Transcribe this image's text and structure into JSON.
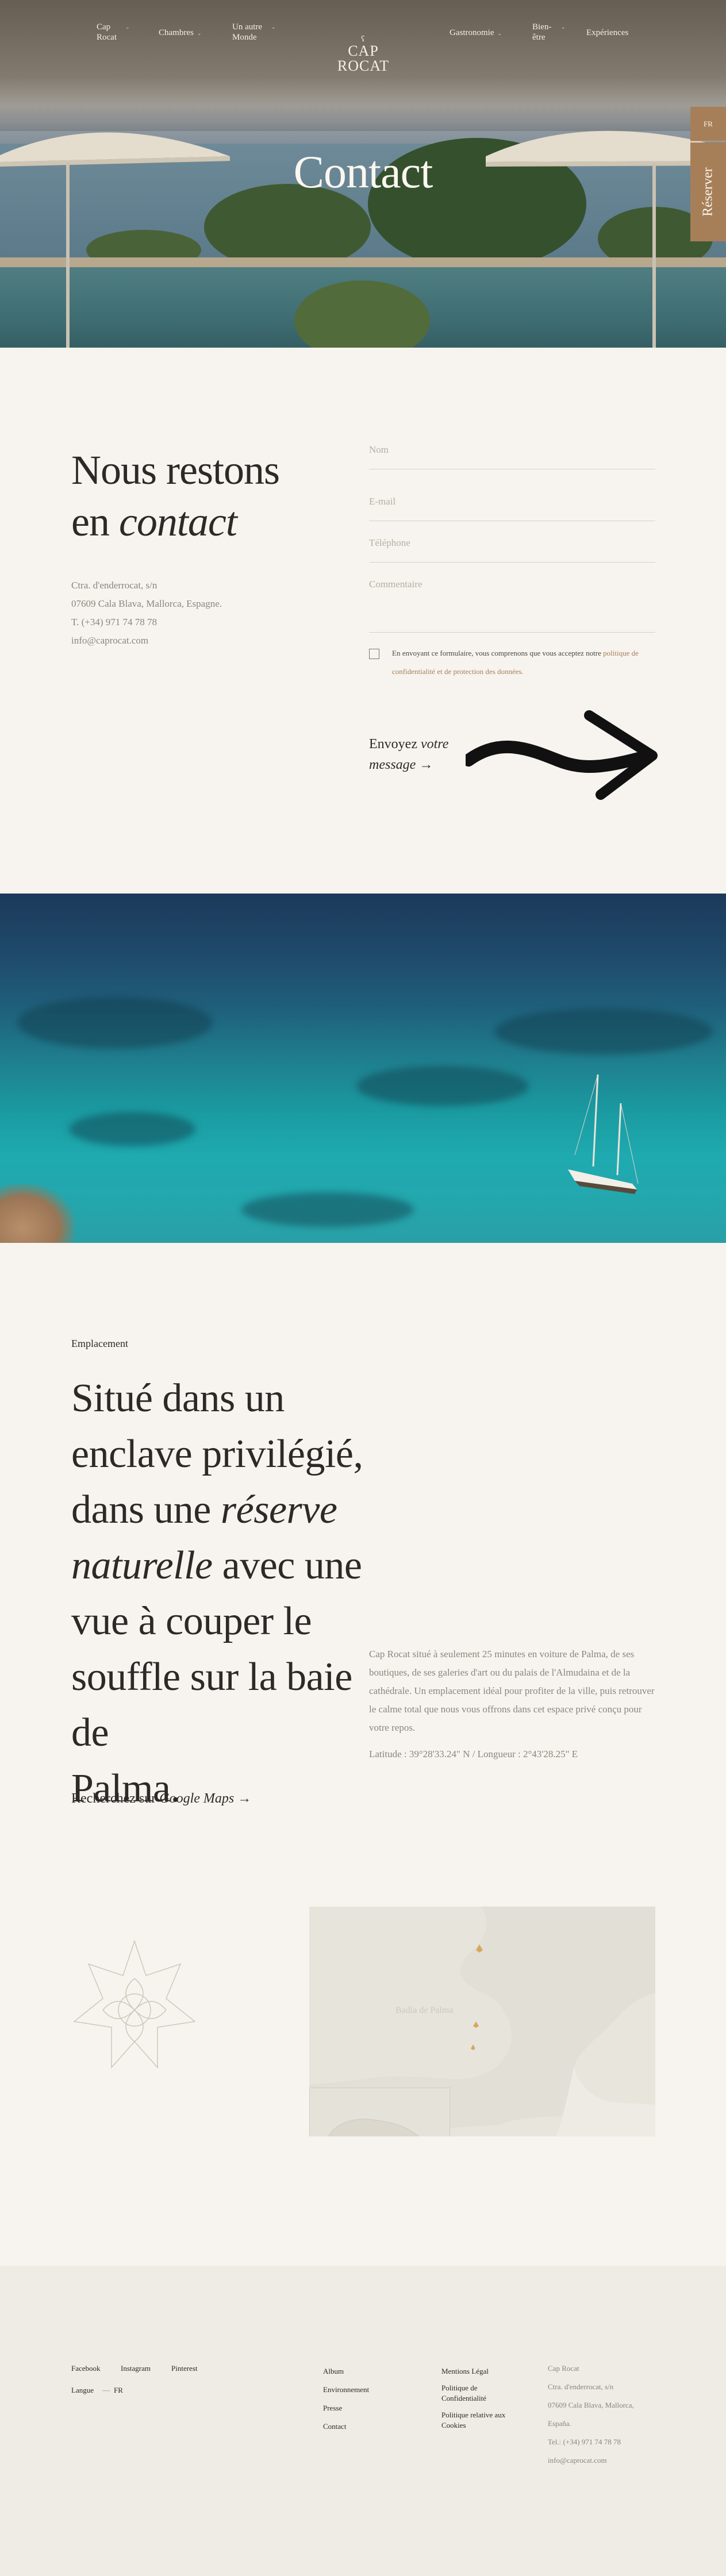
{
  "header": {
    "nav_left": [
      "Cap Rocat",
      "Chambres",
      "Un autre Monde"
    ],
    "nav_right": [
      "Gastronomie",
      "Bien-être",
      "Expériences"
    ],
    "logo_line1": "CAP",
    "logo_line2": "ROCAT",
    "hero_title": "Contact",
    "lang": "FR",
    "reserve": "Réserver"
  },
  "contact": {
    "title_line1": "Nous restons",
    "title_line2_prefix": "en ",
    "title_line2_em": "contact",
    "address": [
      "Ctra. d'enderrocat, s/n",
      "07609 Cala Blava, Mallorca, Espagne.",
      "T. (+34) 971 74 78 78",
      "info@caprocat.com"
    ],
    "form": {
      "name_placeholder": "Nom",
      "email_placeholder": "E-mail",
      "phone_placeholder": "Téléphone",
      "comment_placeholder": "Commentaire",
      "consent_text": "En envoyant ce formulaire, vous comprenons que vous acceptez notre ",
      "consent_link": "politique de confidentialité et de protection des données.",
      "send_prefix": "Envoyez ",
      "send_em": "votre",
      "send_line2": "message",
      "send_arrow": "→"
    }
  },
  "location": {
    "eyebrow": "Emplacement",
    "title_line1": "Situé dans un",
    "title_line2": "enclave privilégié,",
    "title_line3_prefix": "dans une ",
    "title_line3_em": "réserve",
    "title_line4_em": "naturelle",
    "title_line4_suffix": " avec une",
    "title_line5": "vue à couper le",
    "title_line6": "souffle sur la baie de",
    "title_line7": "Palma.",
    "body": "Cap Rocat situé à seulement 25 minutes en voiture de Palma, de ses boutiques, de ses galeries d'art ou du palais de l'Almudaina et de la cathédrale. Un emplacement idéal pour profiter de la ville, puis retrouver le calme total que nous vous offrons dans cet espace privé conçu pour votre repos.",
    "coords": "Latitude : 39°28'33.24\" N / Longueur : 2°43'28.25\" E",
    "maps_prefix": "Recherchez sur ",
    "maps_em": "Google Maps",
    "maps_arrow": "→",
    "map_label": "Badia de Palma"
  },
  "footer": {
    "social": [
      "Facebook",
      "Instagram",
      "Pinterest"
    ],
    "lang_label": "Langue",
    "lang_sep": "—",
    "lang_value": "FR",
    "col2": [
      "Album",
      "Environnement",
      "Presse",
      "Contact"
    ],
    "col3": [
      "Mentions Légal",
      "Politique de",
      "Confidentialité",
      "Politique relative aux",
      "Cookies"
    ],
    "col4": [
      "Cap Rocat",
      "Ctra. d'enderrocat, s/n",
      "07609 Cala Blava, Mallorca,",
      "España.",
      "Tel.: (+34) 971 74 78 78",
      "info@caprocat.com"
    ]
  }
}
